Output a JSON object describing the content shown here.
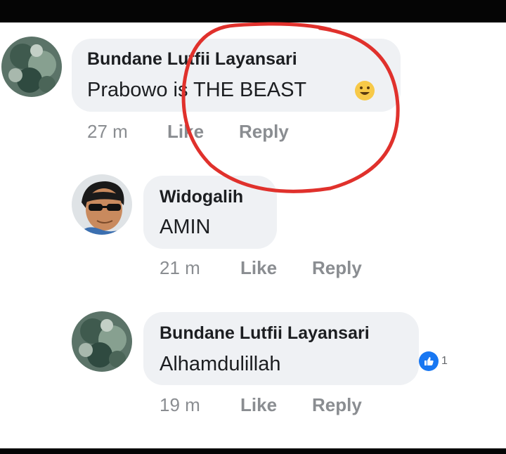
{
  "comments": [
    {
      "author": "Bundane Lutfii Layansari",
      "text": "Prabowo is THE BEAST",
      "emoji": "grinning-face-emoji",
      "time": "27 m",
      "like_label": "Like",
      "reply_label": "Reply"
    },
    {
      "author": "Widogalih",
      "text": "AMIN",
      "time": "21 m",
      "like_label": "Like",
      "reply_label": "Reply"
    },
    {
      "author": "Bundane Lutfii Layansari",
      "text": "Alhamdulillah",
      "reaction_count": "1",
      "reaction_icon": "thumbs-up-icon",
      "time": "19 m",
      "like_label": "Like",
      "reply_label": "Reply"
    }
  ],
  "annotation": {
    "color": "#e0312c"
  },
  "colors": {
    "bubble": "#eff1f4",
    "meta": "#8a8d91",
    "like_blue": "#1877f2"
  }
}
